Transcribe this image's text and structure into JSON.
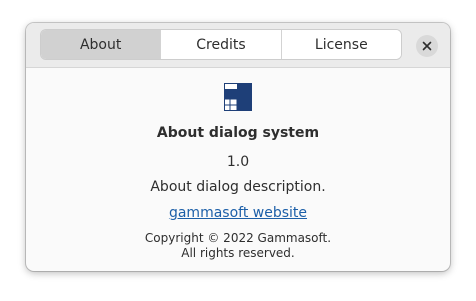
{
  "tabs": [
    {
      "label": "About",
      "active": true
    },
    {
      "label": "Credits",
      "active": false
    },
    {
      "label": "License",
      "active": false
    }
  ],
  "close_icon": "close-icon",
  "logo_icon": "app-logo-icon",
  "app": {
    "name": "About dialog system",
    "version": "1.0",
    "description": "About dialog description.",
    "website_label": "gammasoft website",
    "copyright_line1": "Copyright © 2022 Gammasoft.",
    "copyright_line2": "All rights reserved."
  },
  "colors": {
    "link": "#1c5fa8",
    "logo_primary": "#1e3f78",
    "active_tab": "#d1d1d1"
  }
}
